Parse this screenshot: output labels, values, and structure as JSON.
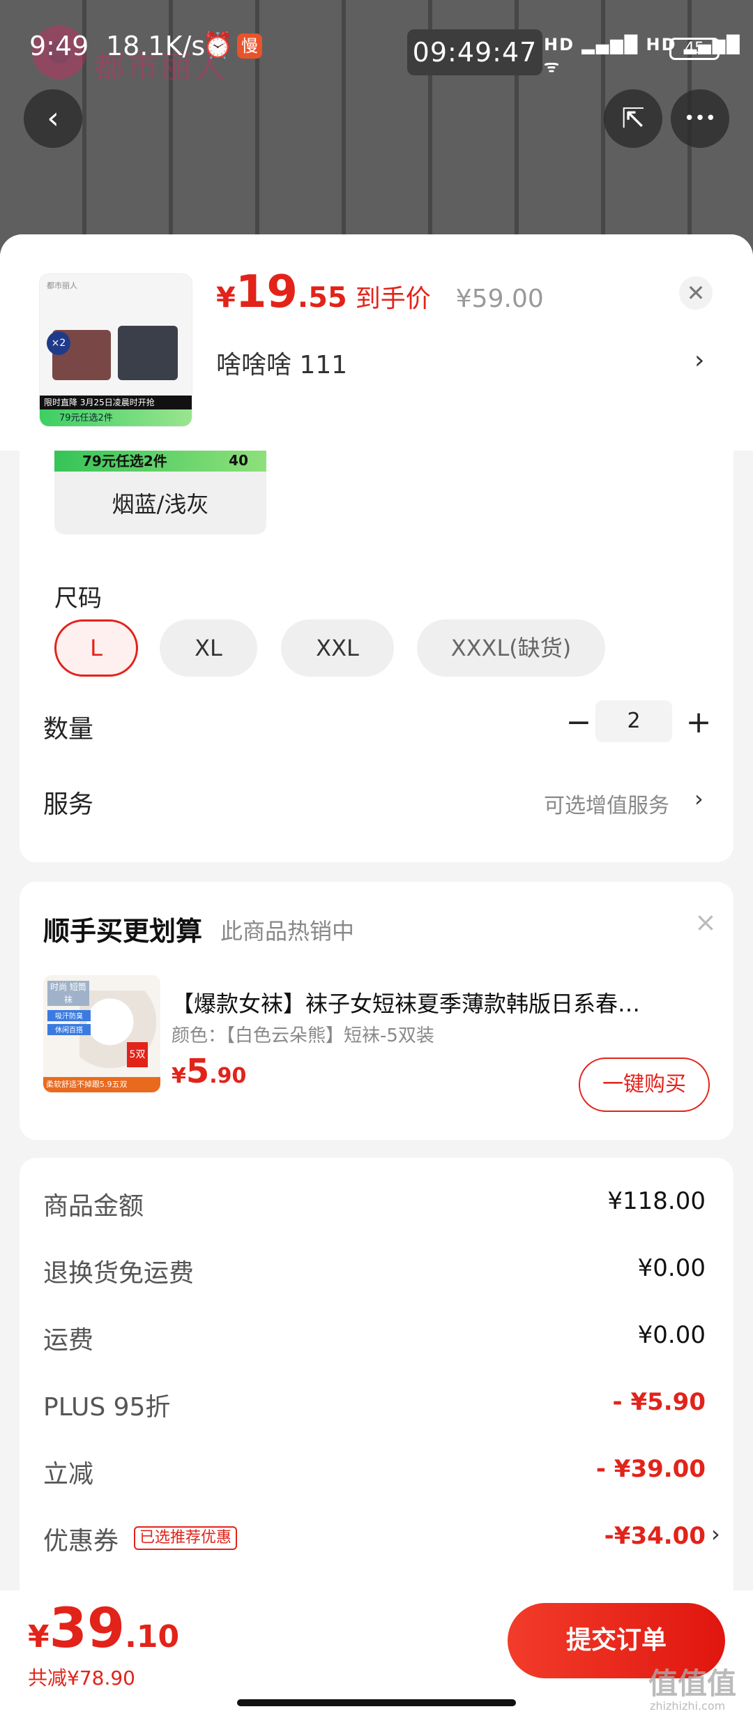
{
  "status_bar": {
    "time": "9:49",
    "network_speed": "18.1K/s",
    "alarm_icon": "⏰",
    "slow_badge": "慢",
    "clock": "09:49:47",
    "signals": "HD ▂▄▆█ HD ▂▄▆█ ᯤ",
    "battery": "45"
  },
  "background": {
    "brand_text": "都市丽人"
  },
  "top_buttons": {
    "back_icon": "‹",
    "share_icon": "⇱",
    "more_icon": "•••"
  },
  "product": {
    "thumb_logo": "都市丽人",
    "thumb_badge": "×2",
    "thumb_bar1": "限时直降   3月25日凌晨时开抢",
    "thumb_bar2": "79元任选2件",
    "price_yen": "¥",
    "price_int": "19",
    "price_dec": ".55",
    "price_tag": "到手价",
    "original_price": "¥59.00",
    "close_icon": "✕",
    "spec_text": "啥啥啥  111",
    "spec_arrow": "›"
  },
  "color_option": {
    "strip_text": "79元任选2件",
    "strip_num": "40",
    "label": "烟蓝/浅灰"
  },
  "size": {
    "label": "尺码",
    "options": [
      {
        "label": "L"
      },
      {
        "label": "XL"
      },
      {
        "label": "XXL"
      },
      {
        "label": "XXXL(缺货)"
      }
    ],
    "selected": "L"
  },
  "quantity": {
    "label": "数量",
    "minus": "−",
    "value": "2",
    "plus": "+"
  },
  "service": {
    "label": "服务",
    "value": "可选增值服务",
    "arrow": "›"
  },
  "upsell": {
    "title": "顺手买更划算",
    "subtitle": "此商品热销中",
    "close_icon": "×",
    "thumb_tag1": "时尚 短筒袜",
    "thumb_tag2": "吸汗防臭",
    "thumb_tag3": "休闲百搭",
    "thumb_badge": "5双",
    "thumb_bottom": "柔软舒适不掉跟5.9五双",
    "name": "【爆款女袜】袜子女短袜夏季薄款韩版日系春…",
    "spec": "颜色：【白色云朵熊】短袜-5双装",
    "price_yen": "¥",
    "price_int": "5",
    "price_dec": ".90",
    "buy_label": "一键购买"
  },
  "summary": {
    "rows": [
      {
        "label": "商品金额",
        "value": "¥118.00"
      },
      {
        "label": "退换货免运费",
        "value": "¥0.00"
      },
      {
        "label": "运费",
        "value": "¥0.00"
      },
      {
        "label": "PLUS 95折",
        "value": "- ¥5.90"
      },
      {
        "label": "立减",
        "value": "- ¥39.00"
      },
      {
        "label": "优惠券",
        "value": "-¥34.00"
      }
    ],
    "coupon_tag": "已选推荐优惠",
    "coupon_arrow": "›"
  },
  "bottom": {
    "total_yen": "¥",
    "total_int": "39",
    "total_dec": ".10",
    "saved": "共减¥78.90",
    "submit_label": "提交订单",
    "watermark": "值值值",
    "watermark_sub": "zhizhizhi.com"
  },
  "colors": {
    "accent_red": "#e2231a",
    "background": "#f4f4f4"
  }
}
